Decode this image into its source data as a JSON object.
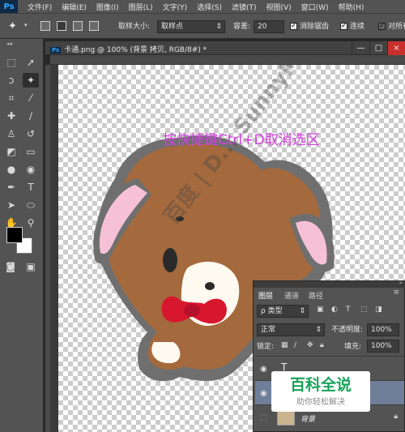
{
  "app": {
    "logo": "Ps"
  },
  "menu": [
    "文件(F)",
    "编辑(E)",
    "图像(I)",
    "图层(L)",
    "文字(Y)",
    "选择(S)",
    "滤镜(T)",
    "视图(V)",
    "窗口(W)",
    "帮助(H)"
  ],
  "window_controls": [
    "—",
    "□",
    "×"
  ],
  "options_bar": {
    "sample_size_label": "取样大小:",
    "sample_size_value": "取样点",
    "tolerance_label": "容差:",
    "tolerance_value": "20",
    "antialias_label": "消除锯齿",
    "contiguous_label": "连续",
    "all_layers_label": "对所有"
  },
  "document": {
    "tab_title": "卡通.png @ 100% (背景 拷贝, RGB/8#) *",
    "tab_controls": [
      "—",
      "□",
      "×"
    ]
  },
  "canvas": {
    "annotation": "按快捷键Ctrl+D取消选区",
    "watermark": "百度 | D... SunnyMelody"
  },
  "layers_panel": {
    "tabs": [
      "图层",
      "通道",
      "路径"
    ],
    "filter_label": "ρ 类型",
    "blend_mode": "正常",
    "opacity_label": "不透明度:",
    "opacity_value": "100%",
    "lock_label": "锁定:",
    "fill_label": "填充:",
    "fill_value": "100%",
    "layers": [
      {
        "name": "T"
      },
      {
        "name": ""
      },
      {
        "name": "背景"
      }
    ]
  },
  "badge": {
    "title": "百科全说",
    "subtitle": "助你轻松解决"
  }
}
